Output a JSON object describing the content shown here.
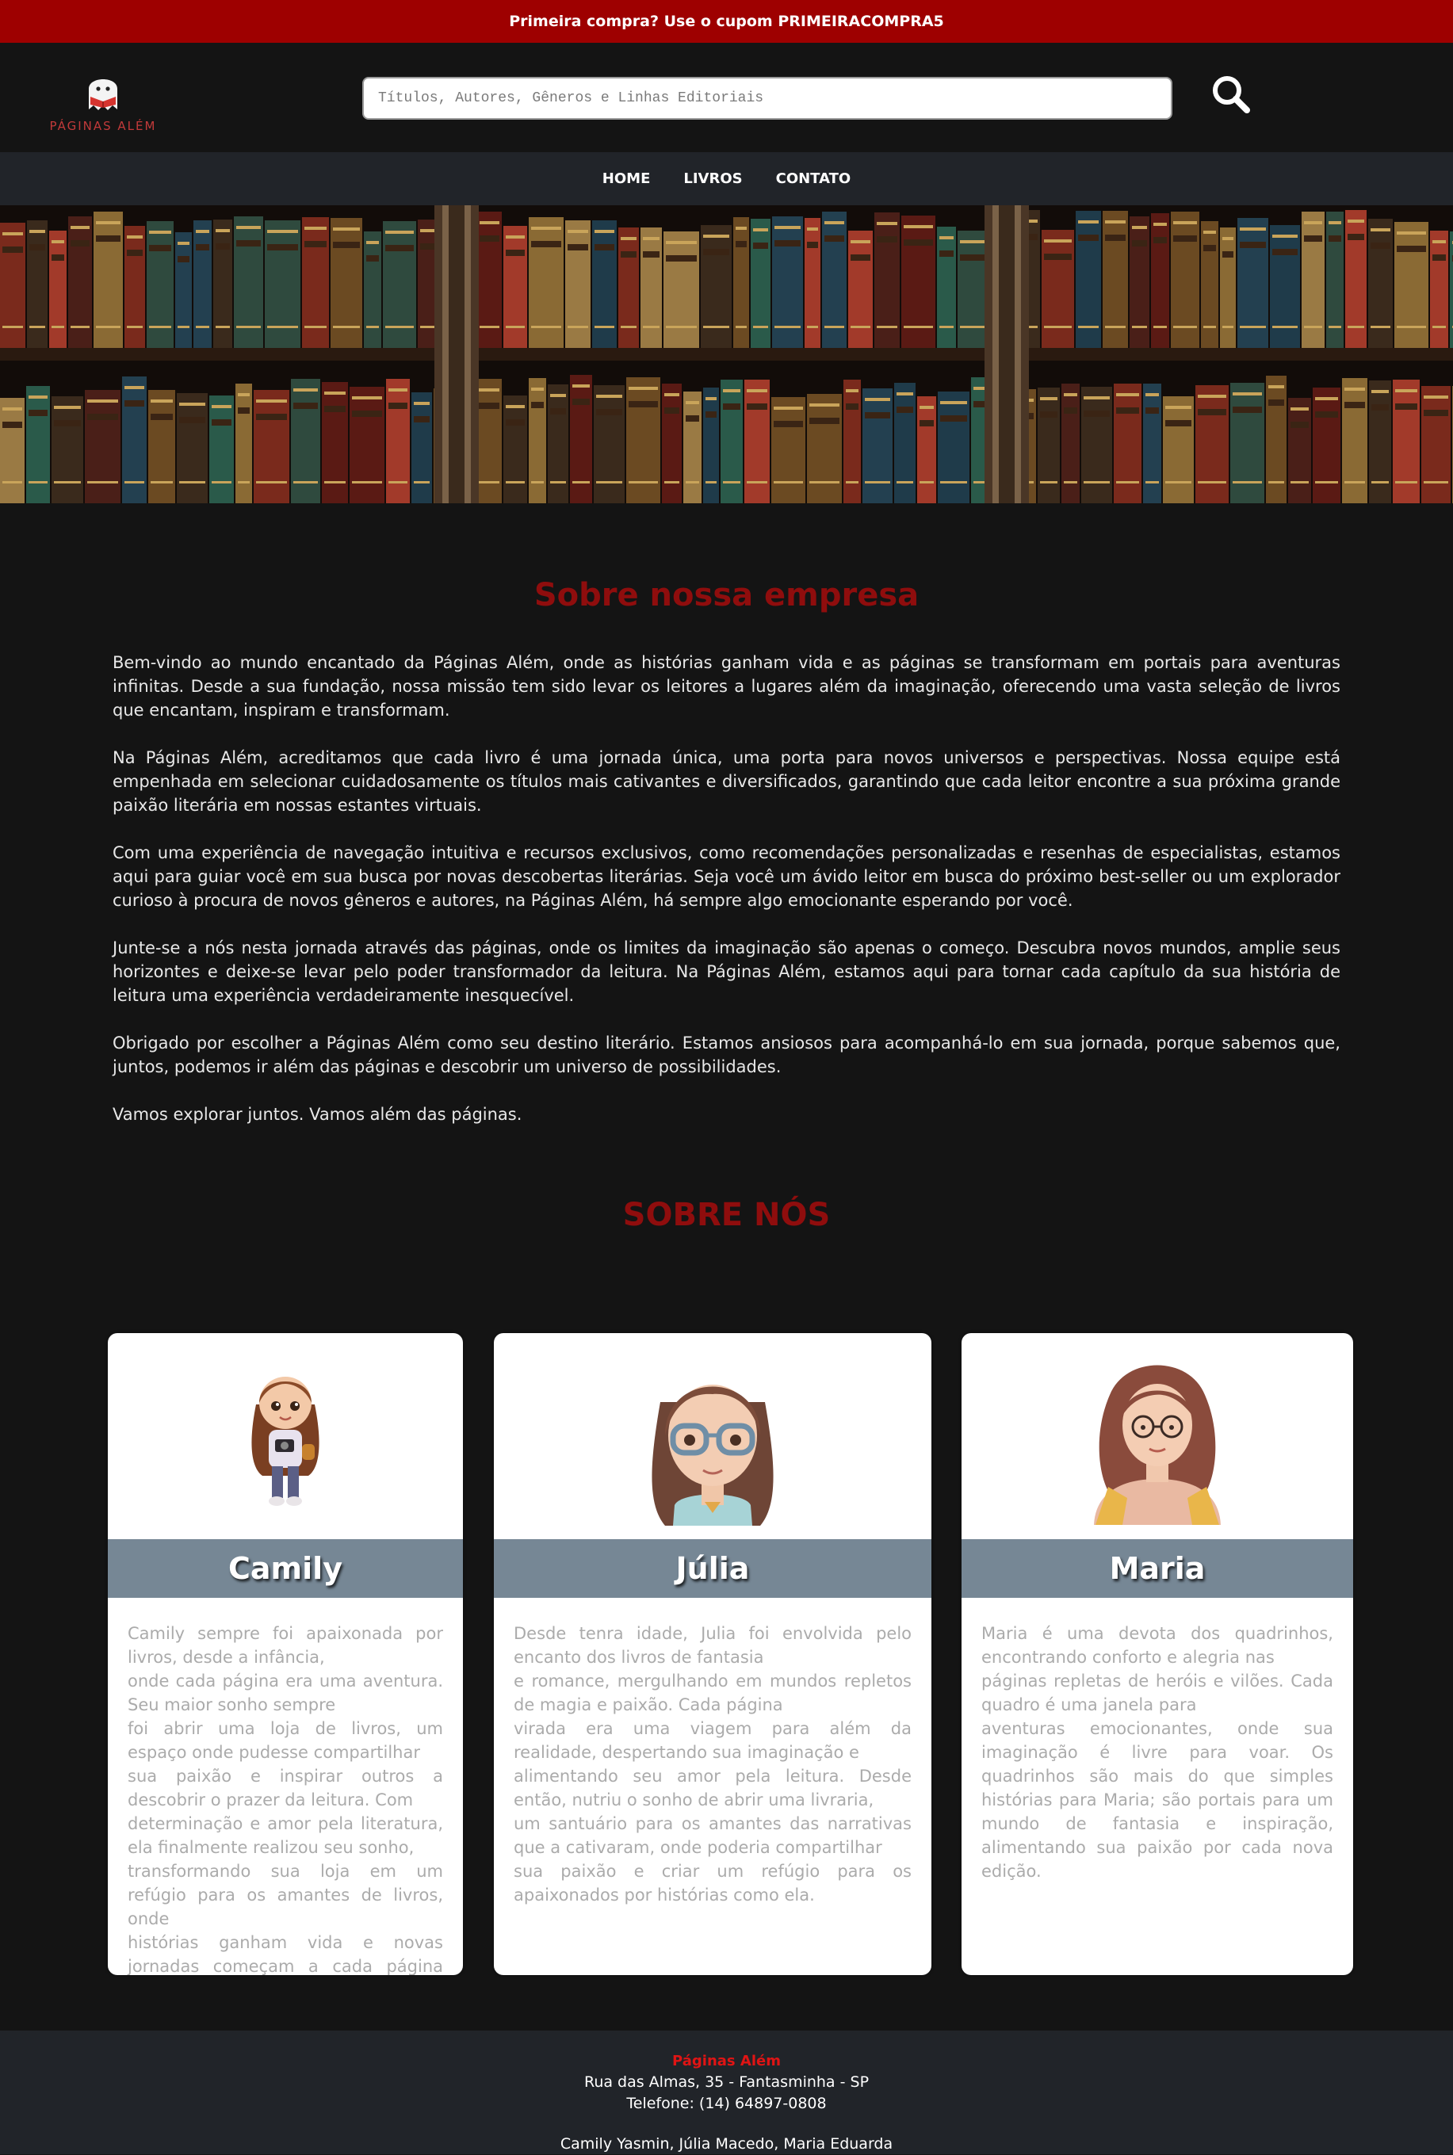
{
  "promo": {
    "text": "Primeira compra? Use o cupom PRIMEIRACOMPRA5"
  },
  "header": {
    "logo_text": "PÁGINAS ALÉM",
    "search_placeholder": "Títulos, Autores, Gêneros e Linhas Editoriais",
    "search_icon": "search-icon"
  },
  "nav": {
    "items": [
      {
        "label": "HOME"
      },
      {
        "label": "LIVROS"
      },
      {
        "label": "CONTATO"
      }
    ]
  },
  "about": {
    "title": "Sobre nossa empresa",
    "paragraphs": [
      "Bem-vindo ao mundo encantado da Páginas Além, onde as histórias ganham vida e as páginas se transformam em portais para aventuras infinitas. Desde a sua fundação, nossa missão tem sido levar os leitores a lugares além da imaginação, oferecendo uma vasta seleção de livros que encantam, inspiram e transformam.",
      "Na Páginas Além, acreditamos que cada livro é uma jornada única, uma porta para novos universos e perspectivas. Nossa equipe está empenhada em selecionar cuidadosamente os títulos mais cativantes e diversificados, garantindo que cada leitor encontre a sua próxima grande paixão literária em nossas estantes virtuais.",
      "Com uma experiência de navegação intuitiva e recursos exclusivos, como recomendações personalizadas e resenhas de especialistas, estamos aqui para guiar você em sua busca por novas descobertas literárias. Seja você um ávido leitor em busca do próximo best-seller ou um explorador curioso à procura de novos gêneros e autores, na Páginas Além, há sempre algo emocionante esperando por você.",
      "Junte-se a nós nesta jornada através das páginas, onde os limites da imaginação são apenas o começo. Descubra novos mundos, amplie seus horizontes e deixe-se levar pelo poder transformador da leitura. Na Páginas Além, estamos aqui para tornar cada capítulo da sua história de leitura uma experiência verdadeiramente inesquecível.",
      "Obrigado por escolher a Páginas Além como seu destino literário. Estamos ansiosos para acompanhá-lo em sua jornada, porque sabemos que, juntos, podemos ir além das páginas e descobrir um universo de possibilidades.",
      "Vamos explorar juntos. Vamos além das páginas."
    ]
  },
  "team": {
    "title": "SOBRE NÓS",
    "members": [
      {
        "name": "Camily",
        "bio": "Camily sempre foi apaixonada por livros, desde a infância,\nonde cada página era uma aventura. Seu maior sonho sempre\nfoi abrir uma loja de livros, um espaço onde pudesse compartilhar\nsua paixão e inspirar outros a descobrir o prazer da leitura. Com\ndeterminação e amor pela literatura, ela finalmente realizou seu sonho,\ntransformando sua loja em um refúgio para os amantes de livros, onde\nhistórias ganham vida e novas jornadas começam a cada página virada."
      },
      {
        "name": "Júlia",
        "bio": "Desde tenra idade, Julia foi envolvida pelo encanto dos livros de fantasia\ne romance, mergulhando em mundos repletos de magia e paixão. Cada página\nvirada era uma viagem para além da realidade, despertando sua imaginação e\nalimentando seu amor pela leitura. Desde então, nutriu o sonho de abrir uma livraria,\num santuário para os amantes das narrativas que a cativaram, onde poderia compartilhar\nsua paixão e criar um refúgio para os apaixonados por histórias como ela."
      },
      {
        "name": "Maria",
        "bio": "Maria é uma devota dos quadrinhos, encontrando conforto e alegria nas\npáginas repletas de heróis e vilões. Cada quadro é uma janela para\naventuras emocionantes, onde sua imaginação é livre para voar. Os quadrinhos são mais do que simples histórias para Maria; são portais para um mundo de fantasia e inspiração, alimentando sua paixão por cada nova edição."
      }
    ]
  },
  "footer": {
    "brand": "Páginas Além",
    "address": "Rua das Almas, 35 - Fantasminha - SP",
    "phone": "Telefone: (14) 64897-0808",
    "credits": "Camily Yasmin, Júlia Macedo, Maria Eduarda"
  },
  "colors": {
    "promo_bg": "#9e0000",
    "accent_red": "#8f0d0d",
    "card_band": "#768795",
    "page_bg": "#141414"
  }
}
